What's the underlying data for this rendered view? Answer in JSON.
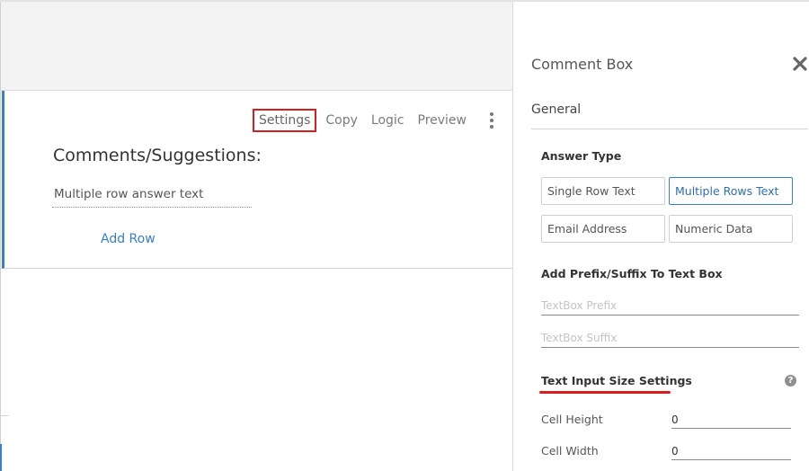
{
  "canvas": {
    "toolbar": {
      "settings": "Settings",
      "copy": "Copy",
      "logic": "Logic",
      "preview": "Preview"
    },
    "question": {
      "title": "Comments/Suggestions:",
      "answer_placeholder": "Multiple row answer text",
      "add_row": "Add Row"
    }
  },
  "panel": {
    "title": "Comment Box",
    "tab": "General",
    "answer_type": {
      "label": "Answer Type",
      "options": [
        "Single Row Text",
        "Multiple Rows Text",
        "Email Address",
        "Numeric Data"
      ],
      "selected": "Multiple Rows Text"
    },
    "prefix_suffix": {
      "label": "Add Prefix/Suffix To Text Box",
      "prefix_placeholder": "TextBox Prefix",
      "suffix_placeholder": "TextBox Suffix"
    },
    "size_settings": {
      "label": "Text Input Size Settings",
      "help_glyph": "?",
      "cell_height_label": "Cell Height",
      "cell_height_value": "0",
      "cell_width_label": "Cell Width",
      "cell_width_value": "0"
    }
  },
  "colors": {
    "accent": "#3a7ec6",
    "highlight": "#d81e1e"
  },
  "icons": {
    "close": "close-icon",
    "more": "kebab-menu-icon",
    "help": "help-icon"
  }
}
